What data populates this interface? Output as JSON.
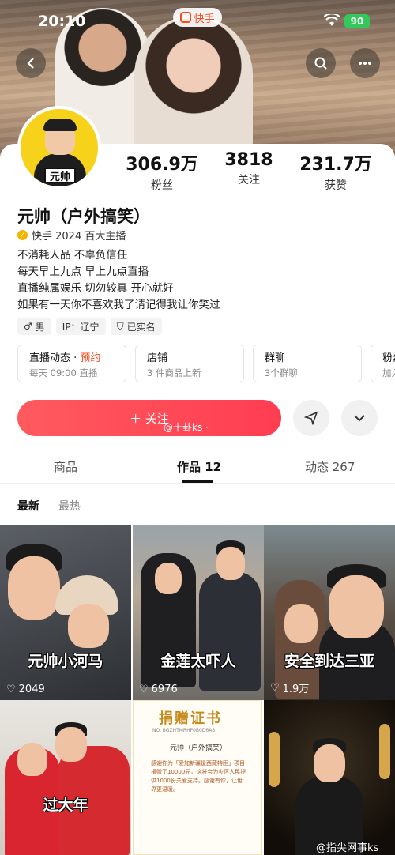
{
  "status_bar": {
    "time": "20:10",
    "app": "快手",
    "battery": "90"
  },
  "profile": {
    "name": "元帅（户外搞笑）",
    "verify": "快手 2024 百大主播",
    "avatar_tag": "元帅",
    "bio": [
      "不消耗人品 不辜负信任",
      "每天早上九点 早上九点直播",
      "直播纯属娱乐 切勿较真 开心就好",
      "如果有一天你不喜欢我了请记得我让你笑过"
    ],
    "tags": [
      "男",
      "IP：辽宁",
      "已实名"
    ]
  },
  "stats": [
    {
      "value": "306.9万",
      "label": "粉丝"
    },
    {
      "value": "3818",
      "label": "关注"
    },
    {
      "value": "231.7万",
      "label": "获赞"
    }
  ],
  "features": [
    {
      "title": "直播动态 · ",
      "highlight": "预约",
      "sub": "每天 09:00 直播"
    },
    {
      "title": "店铺",
      "highlight": "",
      "sub": "3 件商品上新"
    },
    {
      "title": "群聊",
      "highlight": "",
      "sub": "3个群聊"
    },
    {
      "title": "粉丝",
      "highlight": "",
      "sub": "加入"
    }
  ],
  "follow_label": "＋ 关注",
  "watermark_top": "@十卦ks ·",
  "tabs": [
    "商品",
    "作品 12",
    "动态 267"
  ],
  "sort": {
    "latest": "最新",
    "hottest": "最热"
  },
  "videos": [
    {
      "caption": "元帅小河马",
      "likes": "2049"
    },
    {
      "caption": "金莲太吓人",
      "likes": "6976"
    },
    {
      "caption": "安全到达三亚",
      "likes": "1.9万"
    },
    {
      "caption": "过大年",
      "likes": ""
    }
  ],
  "cert": {
    "title": "捐赠证书",
    "no": "NO. BGZHTMRHF0B0D6A8",
    "name": "元帅（户外搞笑）",
    "text": "感谢你为「爱加新疆援西藏特困」项目捐赠了10000元，这将会为灾区人民提供1000份关爱支持。感谢有你，让世界更温暖。"
  },
  "watermark_bottom": "@指尖网事ks"
}
